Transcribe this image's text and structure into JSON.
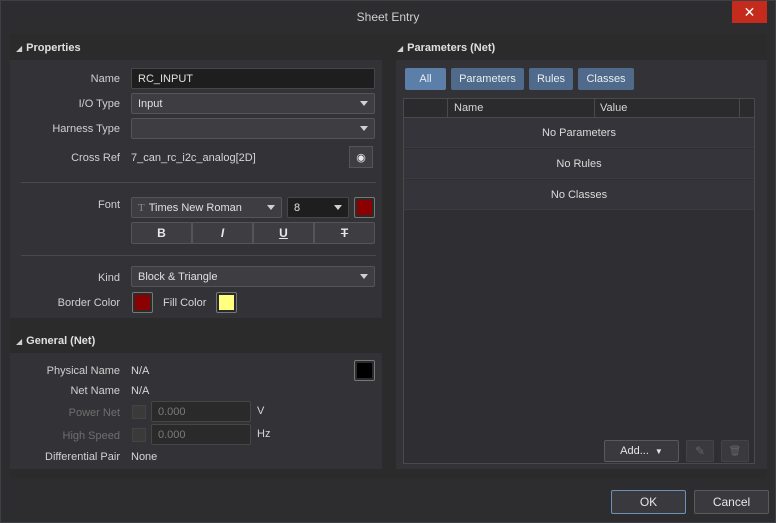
{
  "window": {
    "title": "Sheet Entry",
    "close_glyph": "✕"
  },
  "properties": {
    "header": "Properties",
    "name_label": "Name",
    "name_value": "RC_INPUT",
    "io_type_label": "I/O Type",
    "io_type_value": "Input",
    "harness_type_label": "Harness Type",
    "harness_type_value": "",
    "cross_ref_label": "Cross Ref",
    "cross_ref_value": "7_can_rc_i2c_analog[2D]",
    "font_label": "Font",
    "font_name": "Times New Roman",
    "font_icon": "T",
    "font_size": "8",
    "font_color": "#8b0000",
    "style_bold": "B",
    "style_italic": "I",
    "style_underline": "U",
    "style_strike": "T",
    "kind_label": "Kind",
    "kind_value": "Block & Triangle",
    "border_color_label": "Border Color",
    "border_color": "#8b0000",
    "fill_color_label": "Fill Color",
    "fill_color": "#ffff80"
  },
  "general": {
    "header": "General (Net)",
    "physical_name_label": "Physical Name",
    "physical_name_value": "N/A",
    "physical_color": "#000000",
    "net_name_label": "Net Name",
    "net_name_value": "N/A",
    "power_net_label": "Power Net",
    "power_net_value": "0.000",
    "power_net_unit": "V",
    "high_speed_label": "High Speed",
    "high_speed_value": "0.000",
    "high_speed_unit": "Hz",
    "diff_pair_label": "Differential Pair",
    "diff_pair_value": "None"
  },
  "parameters": {
    "header": "Parameters (Net)",
    "filters": [
      "All",
      "Parameters",
      "Rules",
      "Classes"
    ],
    "columns": [
      "Name",
      "Value"
    ],
    "rows": [
      "No Parameters",
      "No Rules",
      "No Classes"
    ],
    "add_label": "Add...",
    "edit_icon": "✎",
    "delete_icon": "🗑"
  },
  "footer": {
    "ok_label": "OK",
    "cancel_label": "Cancel"
  }
}
